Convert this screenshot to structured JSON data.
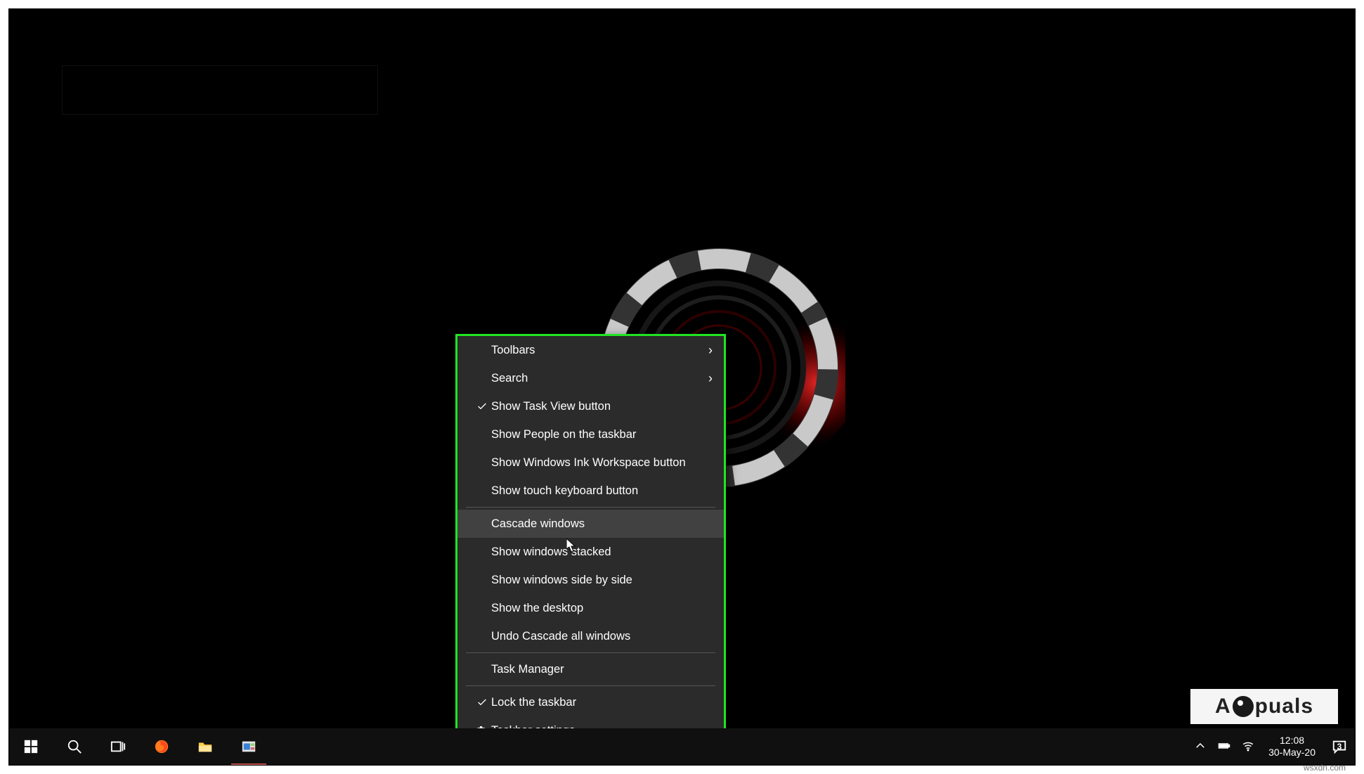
{
  "context_menu": {
    "items": [
      {
        "label": "Toolbars",
        "submenu": true
      },
      {
        "label": "Search",
        "submenu": true
      }
    ],
    "items2": [
      {
        "label": "Show Task View button",
        "checked": true
      },
      {
        "label": "Show People on the taskbar"
      },
      {
        "label": "Show Windows Ink Workspace button"
      },
      {
        "label": "Show touch keyboard button"
      }
    ],
    "items3": [
      {
        "label": "Cascade windows",
        "hovered": true
      },
      {
        "label": "Show windows stacked"
      },
      {
        "label": "Show windows side by side"
      },
      {
        "label": "Show the desktop"
      },
      {
        "label": "Undo Cascade all windows"
      }
    ],
    "items4": [
      {
        "label": "Task Manager"
      }
    ],
    "items5": [
      {
        "label": "Lock the taskbar",
        "checked": true
      },
      {
        "label": "Taskbar settings",
        "gear": true
      }
    ]
  },
  "taskbar": {
    "time": "12:08",
    "date": "30-May-20",
    "notification_count": "3"
  },
  "watermark": {
    "text_left": "A",
    "text_right": "puals"
  },
  "attribution": "wsxdn.com"
}
